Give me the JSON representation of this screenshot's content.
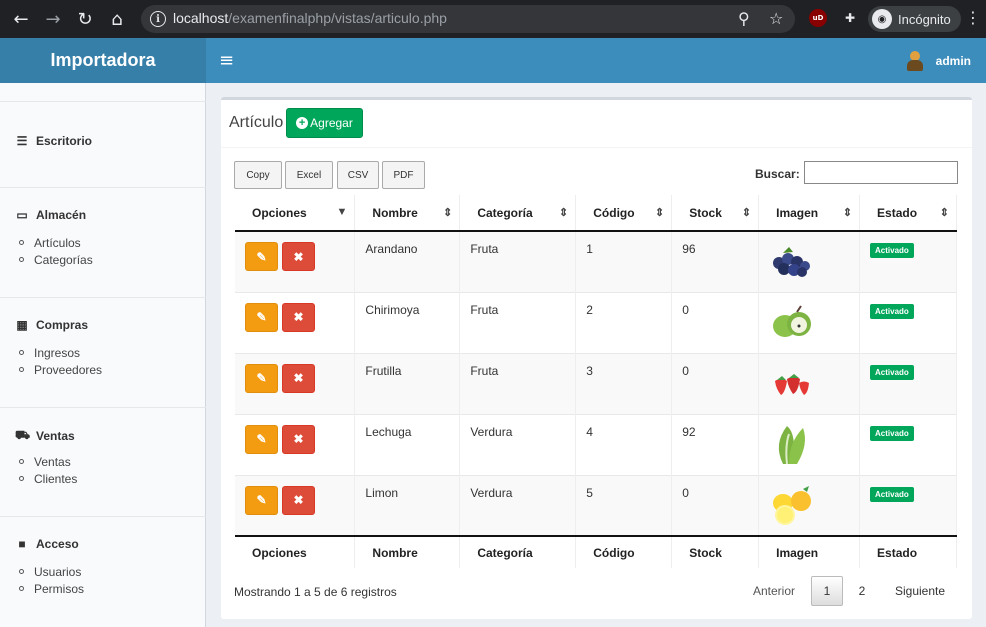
{
  "browser": {
    "url_host": "localhost",
    "url_path": "/examenfinalphp/vistas/articulo.php",
    "incognito_label": "Incógnito",
    "icons": [
      "back-arrow-icon",
      "forward-arrow-icon",
      "reload-icon",
      "home-icon",
      "info-icon",
      "zoom-icon",
      "star-icon",
      "ublock-icon",
      "puzzle-icon",
      "incognito-icon",
      "kebab-menu-icon"
    ]
  },
  "header": {
    "logo": "Importadora",
    "user": "admin",
    "color": "#3c8dbc"
  },
  "sidebar": {
    "sections": [
      {
        "title": "Escritorio",
        "icon": "dashboard-icon",
        "items": []
      },
      {
        "title": "Almacén",
        "icon": "laptop-icon",
        "items": [
          "Artículos",
          "Categorías"
        ]
      },
      {
        "title": "Compras",
        "icon": "grid-icon",
        "items": [
          "Ingresos",
          "Proveedores"
        ]
      },
      {
        "title": "Ventas",
        "icon": "cart-icon",
        "items": [
          "Ventas",
          "Clientes"
        ]
      },
      {
        "title": "Acceso",
        "icon": "folder-icon",
        "items": [
          "Usuarios",
          "Permisos"
        ]
      }
    ]
  },
  "main": {
    "title": "Artículo",
    "add_label": "Agregar",
    "export_buttons": [
      "Copy",
      "Excel",
      "CSV",
      "PDF"
    ],
    "search_label": "Buscar:",
    "search_value": "",
    "columns": [
      "Opciones",
      "Nombre",
      "Categoría",
      "Código",
      "Stock",
      "Imagen",
      "Estado"
    ],
    "rows": [
      {
        "nombre": "Arandano",
        "categoria": "Fruta",
        "codigo": "1",
        "stock": "96",
        "imagen": "blueberries",
        "estado": "Activado"
      },
      {
        "nombre": "Chirimoya",
        "categoria": "Fruta",
        "codigo": "2",
        "stock": "0",
        "imagen": "cherimoya",
        "estado": "Activado"
      },
      {
        "nombre": "Frutilla",
        "categoria": "Fruta",
        "codigo": "3",
        "stock": "0",
        "imagen": "strawberries",
        "estado": "Activado"
      },
      {
        "nombre": "Lechuga",
        "categoria": "Verdura",
        "codigo": "4",
        "stock": "92",
        "imagen": "lettuce",
        "estado": "Activado"
      },
      {
        "nombre": "Limon",
        "categoria": "Verdura",
        "codigo": "5",
        "stock": "0",
        "imagen": "lemons",
        "estado": "Activado"
      }
    ],
    "info": "Mostrando 1 a 5 de 6 registros",
    "pagination": {
      "prev": "Anterior",
      "pages": [
        "1",
        "2"
      ],
      "current": "1",
      "next": "Siguiente"
    }
  }
}
